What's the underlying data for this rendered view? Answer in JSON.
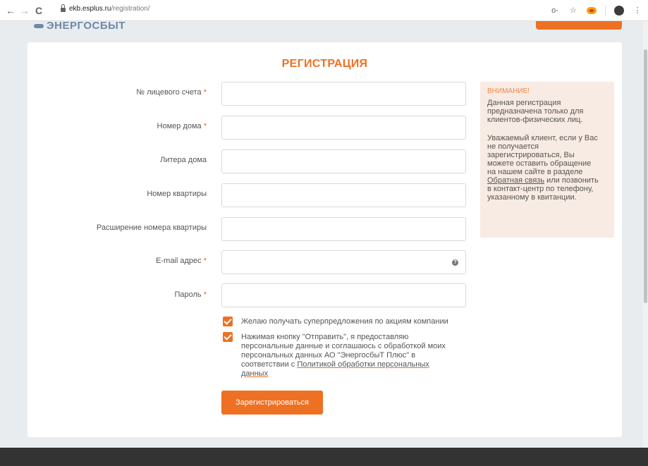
{
  "browser": {
    "back_icon": "←",
    "forward_icon": "→",
    "reload_icon": "C",
    "url_host": "ekb.esplus.ru",
    "url_path": "/registration/",
    "key_icon": "o-",
    "star_icon": "☆",
    "menu_icon": "⋮"
  },
  "header": {
    "logo_text": "ЭНЕРГОСБЫТ"
  },
  "form": {
    "title": "РЕГИСТРАЦИЯ",
    "required_mark": "*",
    "fields": [
      {
        "label": "№ лицевого счета",
        "required": true,
        "value": ""
      },
      {
        "label": "Номер дома",
        "required": true,
        "value": ""
      },
      {
        "label": "Литера дома",
        "required": false,
        "value": ""
      },
      {
        "label": "Номер квартиры",
        "required": false,
        "value": ""
      },
      {
        "label": "Расширение номера квартиры",
        "required": false,
        "value": ""
      },
      {
        "label": "E-mail адрес",
        "required": true,
        "value": ""
      },
      {
        "label": "Пароль",
        "required": true,
        "value": ""
      }
    ],
    "help_icon": "?",
    "checkbox_offers": {
      "checked": true,
      "label": "Желаю получать суперпредложения по акциям компании"
    },
    "checkbox_consent": {
      "checked": true,
      "line1": "Нажимая кнопку \"Отправить\", я предоставляю",
      "line2": "персональные данные и соглашаюсь с обработкой моих",
      "line3": "персональных данных АО \"ЭнергосбыТ Плюс\" в",
      "line4_prefix": "соответствии с ",
      "line4_link": "Политикой обработки персональных",
      "line5_link": "данных"
    },
    "submit_label": "Зарегистрироваться"
  },
  "notice": {
    "heading": "ВНИМАНИЕ!",
    "p1_l1": "Данная регистрация",
    "p1_l2": "предназначена только для",
    "p1_l3": "клиентов-физических лиц.",
    "p2_l1": "Уважаемый клиент, если у Вас",
    "p2_l2": "не получается",
    "p2_l3": "зарегистрироваться, Вы",
    "p2_l4": "можете оставить обращение",
    "p2_l5": "на нашем сайте в разделе",
    "p2_link": "Обратная связь",
    "p2_l6_suffix": " или позвонить",
    "p2_l7": "в контакт-центр по телефону,",
    "p2_l8": "указанному в квитанции."
  },
  "colors": {
    "accent": "#ee7023",
    "notice_bg": "#f8ebe3",
    "footer": "#333333"
  }
}
